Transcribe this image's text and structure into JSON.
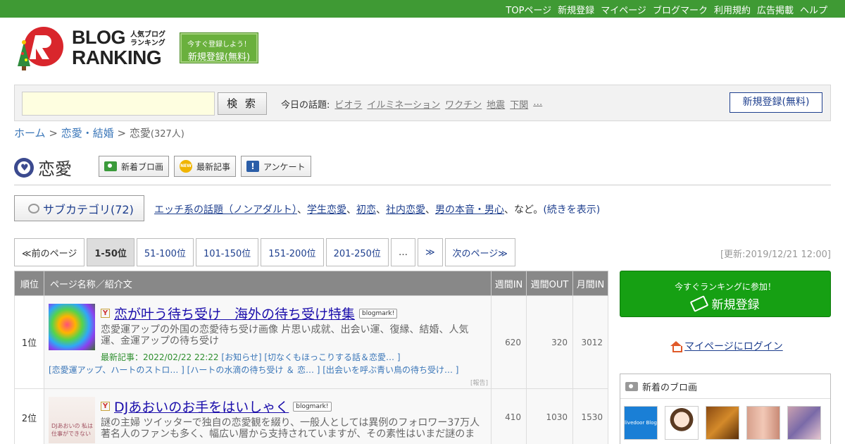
{
  "topnav": [
    "TOPページ",
    "新規登録",
    "マイページ",
    "ブログマーク",
    "利用規約",
    "広告掲載",
    "ヘルプ"
  ],
  "logo": {
    "line1": "BLOG",
    "line2": "RANKING",
    "jp1": "人気ブログ",
    "jp2": "ランキング"
  },
  "header_register": {
    "small": "今すぐ登録しよう！",
    "label": "新規登録(無料)"
  },
  "search": {
    "button": "検 索",
    "topics_label": "今日の話題:",
    "topics": [
      "ビオラ",
      "イルミネーション",
      "ワクチン",
      "地震",
      "下関",
      "…"
    ],
    "register": "新規登録(無料)"
  },
  "breadcrumb": {
    "home": "ホーム",
    "sep1": ">",
    "parent": "恋愛・結婚",
    "sep2": ">",
    "current": "恋愛",
    "count": "(327人)"
  },
  "category": {
    "name": "恋愛",
    "buttons": [
      "新着ブロ画",
      "最新記事",
      "アンケート"
    ]
  },
  "subcategory": {
    "button": "サブカテゴリ(72)",
    "links": [
      "エッチ系の話題（ノンアダルト）",
      "学生恋愛",
      "初恋",
      "社内恋愛",
      "男の本音・男心"
    ],
    "suffix": "など。",
    "more": "(続きを表示)"
  },
  "pager": {
    "prev": "≪前のページ",
    "pages": [
      "1-50位",
      "51-100位",
      "101-150位",
      "151-200位",
      "201-250位"
    ],
    "dots": "…",
    "skip": "≫",
    "next": "次のページ≫"
  },
  "updated": "[更新:2019/12/21 12:00]",
  "table": {
    "headers": {
      "rank": "順位",
      "name": "ページ名称／紹介文",
      "in_week": "週間IN",
      "out_week": "週間OUT",
      "in_month": "月間IN"
    },
    "rows": [
      {
        "rank": "1位",
        "title": "恋が叶う待ち受け　海外の待ち受け特集",
        "bm": "blogmark!",
        "desc": "恋愛運アップの外国の恋愛待ち受け画像 片思い成就、出会い運、復縁、結婚、人気運、金運アップの待ち受け",
        "latest_label": "最新記事：2022/02/22 22:22",
        "latest_links": "[お知らせ] [切なくもほっこりする話＆恋愛… ]",
        "more_links": "[恋愛運アップ、ハートのストロ… ] [ハートの水滴の待ち受け ＆ 恋… ] [出会いを呼ぶ青い鳥の待ち受け… ]",
        "report": "[報告]",
        "in_week": "620",
        "out_week": "320",
        "in_month": "3012"
      },
      {
        "rank": "2位",
        "title": "DJあおいのお手をはいしゃく",
        "bm": "blogmark!",
        "thumb_text": "DJあおいの 私は仕事ができない",
        "desc": "謎の主婦 ツイッターで独自の恋愛観を綴り、一般人としては異例のフォロワー37万人 著名人のファンも多く、幅広い層から支持されていますが、その素性はいまだ謎のま",
        "in_week": "410",
        "out_week": "1030",
        "in_month": "1530"
      }
    ]
  },
  "sidebar": {
    "join_small": "今すぐランキングに参加！",
    "join_label": "新規登録",
    "login": "マイページにログイン",
    "new_pics_title": "新着のブロ画",
    "pic1_text": "livedoor Blog"
  }
}
